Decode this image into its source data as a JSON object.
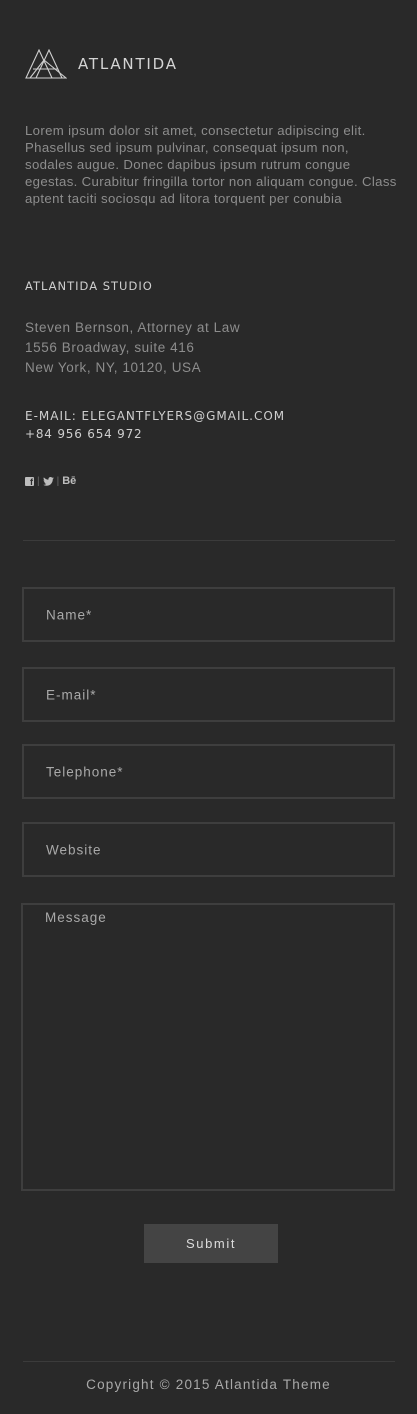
{
  "brand": {
    "name": "ATLANTIDA",
    "logo_icon": "triangles-logo-icon"
  },
  "intro": {
    "text": "Lorem ipsum dolor sit amet, consectetur adipiscing elit. Phasellus sed ipsum pulvinar, consequat ipsum non, sodales augue. Donec dapibus ipsum rutrum congue egestas. Curabitur fringilla tortor non aliquam congue. Class aptent taciti sociosqu ad litora torquent per conubia"
  },
  "studio": {
    "title": "ATLANTIDA STUDIO",
    "address_lines": [
      "Steven Bernson, Attorney at Law",
      "1556 Broadway, suite 416",
      "New York, NY, 10120, USA"
    ],
    "email": "E-MAIL: ELEGANTFLYERS@GMAIL.COM",
    "phone": "+84 956 654 972"
  },
  "social": {
    "separator": "|",
    "items": [
      {
        "name": "facebook-icon",
        "glyph": "f"
      },
      {
        "name": "twitter-icon"
      },
      {
        "name": "behance-icon",
        "glyph": "Bē"
      }
    ]
  },
  "form": {
    "name_placeholder": "Name*",
    "email_placeholder": "E-mail*",
    "telephone_placeholder": "Telephone*",
    "website_placeholder": "Website",
    "message_placeholder": "Message",
    "submit_label": "Submit"
  },
  "footer": {
    "copyright": "Copyright © 2015 Atlantida Theme"
  },
  "colors": {
    "background": "#292929",
    "field_border": "#3e3e3e",
    "button_bg": "#444444",
    "text_muted": "#8d8d8d",
    "text_light": "#cfcfcf"
  }
}
